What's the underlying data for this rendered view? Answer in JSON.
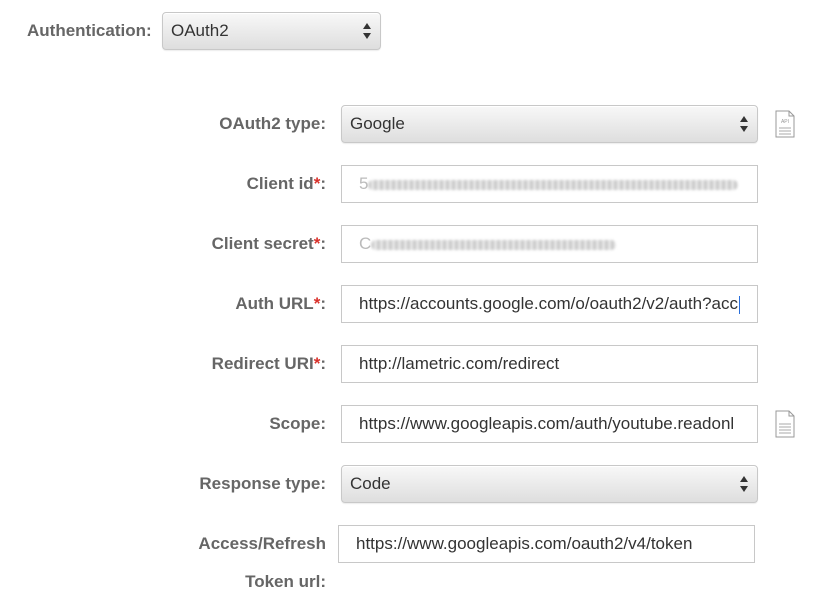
{
  "authentication": {
    "label": "Authentication:",
    "value": "OAuth2"
  },
  "oauth2_type": {
    "label": "OAuth2 type:",
    "value": "Google",
    "icon": "api-doc-icon"
  },
  "client_id": {
    "label": "Client id",
    "required": "*",
    "suffix": ":",
    "value": "5"
  },
  "client_secret": {
    "label": "Client secret",
    "required": "*",
    "suffix": ":",
    "value": "C"
  },
  "auth_url": {
    "label": "Auth URL",
    "required": "*",
    "suffix": ":",
    "value": "https://accounts.google.com/o/oauth2/v2/auth?acc"
  },
  "redirect_uri": {
    "label": "Redirect URI",
    "required": "*",
    "suffix": ":",
    "value": "http://lametric.com/redirect"
  },
  "scope": {
    "label": "Scope:",
    "value": "https://www.googleapis.com/auth/youtube.readonl",
    "icon": "doc-icon"
  },
  "response_type": {
    "label": "Response type:",
    "value": "Code"
  },
  "token_url": {
    "label_line1": "Access/Refresh",
    "label_line2": "Token url:",
    "value": "https://www.googleapis.com/oauth2/v4/token"
  },
  "colors": {
    "required": "#d9302a",
    "label": "#666666",
    "border": "#c8c8c8"
  }
}
